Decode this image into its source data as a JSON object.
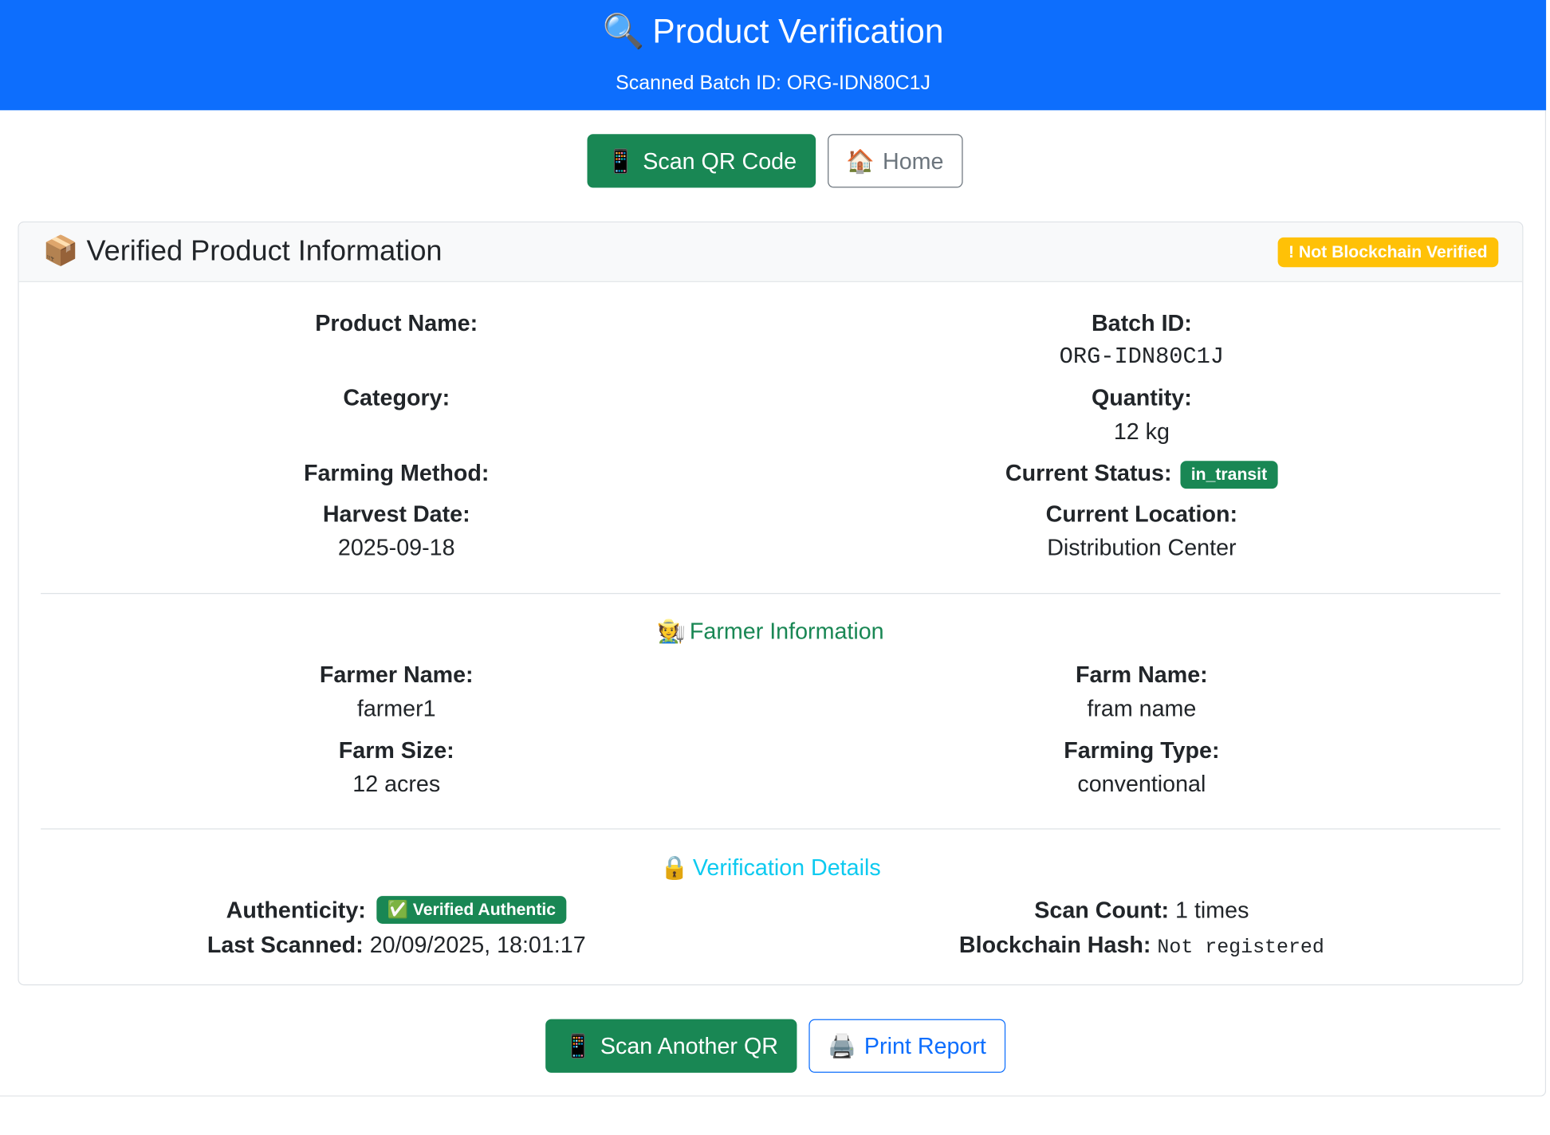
{
  "header": {
    "icon": "magnifier-icon",
    "icon_glyph": "🔍",
    "title": "Product Verification",
    "subtitle": "Scanned Batch ID: ORG-IDN80C1J"
  },
  "top_actions": {
    "scan_qr": {
      "icon_glyph": "📱",
      "label": "Scan QR Code"
    },
    "home": {
      "icon_glyph": "🏠",
      "label": "Home"
    }
  },
  "card": {
    "icon_glyph": "📦",
    "title": "Verified Product Information",
    "blockchain_badge": "! Not Blockchain Verified",
    "product": {
      "product_name_label": "Product Name:",
      "product_name_value": "",
      "category_label": "Category:",
      "category_value": "",
      "farming_method_label": "Farming Method:",
      "farming_method_value": "",
      "harvest_date_label": "Harvest Date:",
      "harvest_date_value": "2025-09-18",
      "batch_id_label": "Batch ID:",
      "batch_id_value": "ORG-IDN80C1J",
      "quantity_label": "Quantity:",
      "quantity_value": "12 kg",
      "current_status_label": "Current Status:",
      "current_status_value": "in_transit",
      "current_location_label": "Current Location:",
      "current_location_value": "Distribution Center"
    },
    "farmer": {
      "icon_glyph": "🧑‍🌾",
      "title": "Farmer Information",
      "farmer_name_label": "Farmer Name:",
      "farmer_name_value": "farmer1",
      "farm_size_label": "Farm Size:",
      "farm_size_value": "12 acres",
      "farm_name_label": "Farm Name:",
      "farm_name_value": "fram name",
      "farming_type_label": "Farming Type:",
      "farming_type_value": "conventional"
    },
    "verification": {
      "icon_glyph": "🔒",
      "title": "Verification Details",
      "authenticity_label": "Authenticity:",
      "authenticity_value": "✅ Verified Authentic",
      "last_scanned_label": "Last Scanned:",
      "last_scanned_value": "20/09/2025, 18:01:17",
      "scan_count_label": "Scan Count:",
      "scan_count_value": "1 times",
      "blockchain_hash_label": "Blockchain Hash:",
      "blockchain_hash_value": "Not registered"
    }
  },
  "bottom_actions": {
    "scan_another": {
      "icon_glyph": "📱",
      "label": "Scan Another QR"
    },
    "print_report": {
      "icon_glyph": "🖨️",
      "label": "Print Report"
    }
  },
  "colors": {
    "primary": "#0d6efd",
    "success": "#198754",
    "warning": "#ffc107",
    "info": "#0dcaf0",
    "secondary": "#6c757d"
  }
}
